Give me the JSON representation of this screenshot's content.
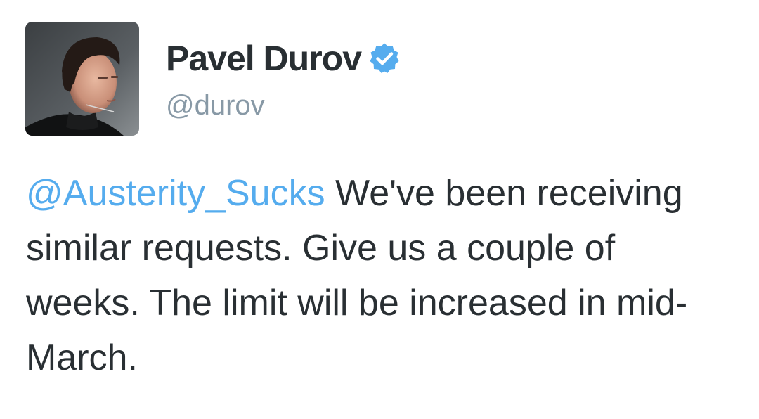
{
  "tweet": {
    "author": {
      "display_name": "Pavel Durov",
      "handle": "@durov",
      "verified": true,
      "avatar_icon": "profile-photo"
    },
    "body": {
      "mention": "@Austerity_Sucks",
      "text": " We've been receiving similar requests. Give us a couple of weeks. The limit will be increased in mid-March."
    }
  },
  "colors": {
    "name": "#292f33",
    "handle": "#8899a6",
    "mention": "#55acee",
    "verified_badge": "#55acee",
    "background": "#ffffff"
  }
}
